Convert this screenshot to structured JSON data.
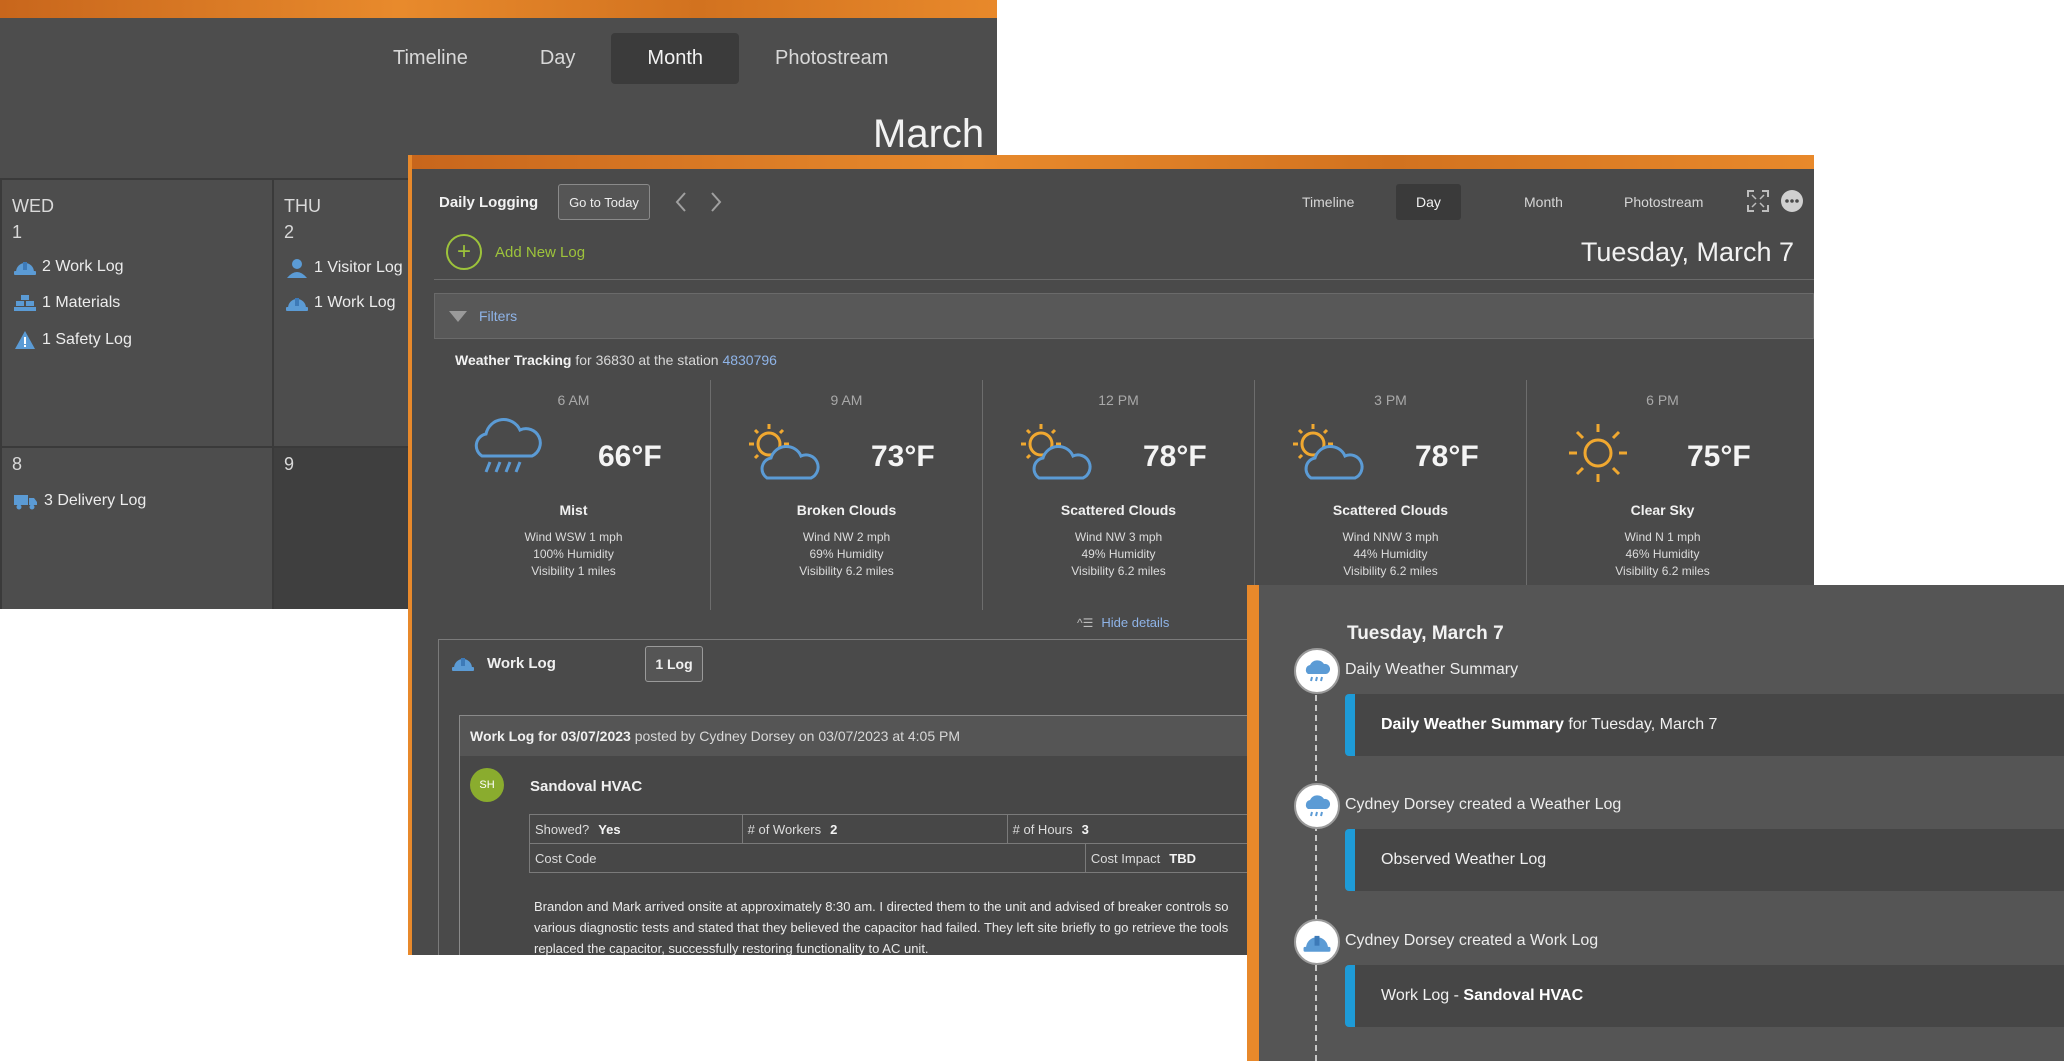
{
  "month_view": {
    "tabs": [
      "Timeline",
      "Day",
      "Month",
      "Photostream"
    ],
    "active_tab": "Month",
    "title": "March",
    "days": [
      {
        "dow": "WED",
        "num": "1",
        "items": [
          {
            "icon": "hardhat-icon",
            "text": "2 Work Log"
          },
          {
            "icon": "materials-icon",
            "text": "1 Materials"
          },
          {
            "icon": "warning-icon",
            "text": "1 Safety Log"
          }
        ]
      },
      {
        "dow": "THU",
        "num": "2",
        "items": [
          {
            "icon": "person-icon",
            "text": "1 Visitor Log"
          },
          {
            "icon": "hardhat-icon",
            "text": "1 Work Log"
          }
        ]
      },
      {
        "num": "8",
        "items": [
          {
            "icon": "truck-icon",
            "text": "3 Delivery Log"
          }
        ]
      },
      {
        "num": "9",
        "items": []
      }
    ]
  },
  "day_view": {
    "app_title": "Daily Logging",
    "go_today": "Go to Today",
    "tabs": [
      "Timeline",
      "Day",
      "Month",
      "Photostream"
    ],
    "active_tab": "Day",
    "add_new": "Add New Log",
    "date": "Tuesday, March 7",
    "filters": "Filters",
    "weather_title": "Weather Tracking",
    "weather_for": "for 36830 at the station",
    "station": "4830796",
    "forecast": [
      {
        "time": "6 AM",
        "icon": "rain-cloud-icon",
        "temp": "66°F",
        "cond": "Mist",
        "wind": "Wind WSW 1 mph",
        "humidity": "100% Humidity",
        "visibility": "Visibility 1 miles"
      },
      {
        "time": "9 AM",
        "icon": "partly-cloudy-icon",
        "temp": "73°F",
        "cond": "Broken Clouds",
        "wind": "Wind NW 2 mph",
        "humidity": "69% Humidity",
        "visibility": "Visibility 6.2 miles"
      },
      {
        "time": "12 PM",
        "icon": "partly-cloudy-icon",
        "temp": "78°F",
        "cond": "Scattered Clouds",
        "wind": "Wind NW 3 mph",
        "humidity": "49% Humidity",
        "visibility": "Visibility 6.2 miles"
      },
      {
        "time": "3 PM",
        "icon": "partly-cloudy-icon",
        "temp": "78°F",
        "cond": "Scattered Clouds",
        "wind": "Wind NNW 3 mph",
        "humidity": "44% Humidity",
        "visibility": "Visibility 6.2 miles"
      },
      {
        "time": "6 PM",
        "icon": "sun-icon",
        "temp": "75°F",
        "cond": "Clear Sky",
        "wind": "Wind N 1 mph",
        "humidity": "46% Humidity",
        "visibility": "Visibility 6.2 miles"
      }
    ],
    "hide_details": "Hide details",
    "work_log": {
      "title": "Work Log",
      "badge": "1 Log",
      "entry_title": "Work Log for 03/07/2023",
      "entry_meta": "posted by Cydney Dorsey on 03/07/2023 at 4:05 PM",
      "avatar": "SH",
      "company": "Sandoval HVAC",
      "showed_label": "Showed?",
      "showed_value": "Yes",
      "workers_label": "# of Workers",
      "workers_value": "2",
      "hours_label": "# of Hours",
      "hours_value": "3",
      "cost_code_label": "Cost Code",
      "cost_impact_label": "Cost Impact",
      "cost_impact_value": "TBD",
      "notes": [
        "Brandon and Mark arrived onsite at approximately 8:30 am. I directed them to the unit and advised of breaker controls so",
        "various diagnostic tests and stated that they believed the capacitor had failed. They left site briefly to go retrieve the tools",
        "replaced the capacitor, successfully restoring functionality to AC unit."
      ]
    }
  },
  "timeline_view": {
    "date": "Tuesday, March 7",
    "events": [
      {
        "icon": "rain-cloud-icon",
        "label": "Daily Weather Summary",
        "card_bold": "Daily Weather Summary",
        "card_text": " for Tuesday, March 7"
      },
      {
        "icon": "rain-cloud-icon",
        "label": "Cydney Dorsey created a Weather Log",
        "card_text": "Observed Weather Log"
      },
      {
        "icon": "hardhat-icon",
        "label": "Cydney Dorsey created a Work Log",
        "card_text": "Work Log - ",
        "card_bold": "Sandoval HVAC"
      }
    ]
  },
  "colors": {
    "accent_orange": "#e8892b",
    "add_green": "#9dc33b",
    "link_blue": "#8fb4e8",
    "timeline_blue": "#1e9bd7",
    "sun_orange": "#f0a830",
    "icon_blue": "#5b9bd5"
  }
}
